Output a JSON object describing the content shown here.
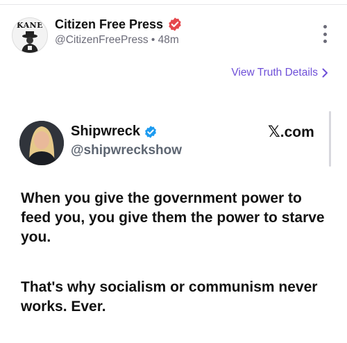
{
  "post": {
    "avatar_text": "KANE",
    "author": "Citizen Free Press",
    "handle": "@CitizenFreePress",
    "time": "48m",
    "view_details": "View Truth Details"
  },
  "embed": {
    "name": "Shipwreck",
    "handle": "@shipwreckshow",
    "source_mark": "𝕏",
    "source_suffix": ".com",
    "paragraphs": [
      "When you give the government power to feed you, you give them the power to starve you.",
      "That's why socialism or communism never works. Ever."
    ]
  },
  "colors": {
    "accent": "#6e4fd8",
    "badge": "#e5484d",
    "x_verified": "#1d9bf0"
  }
}
